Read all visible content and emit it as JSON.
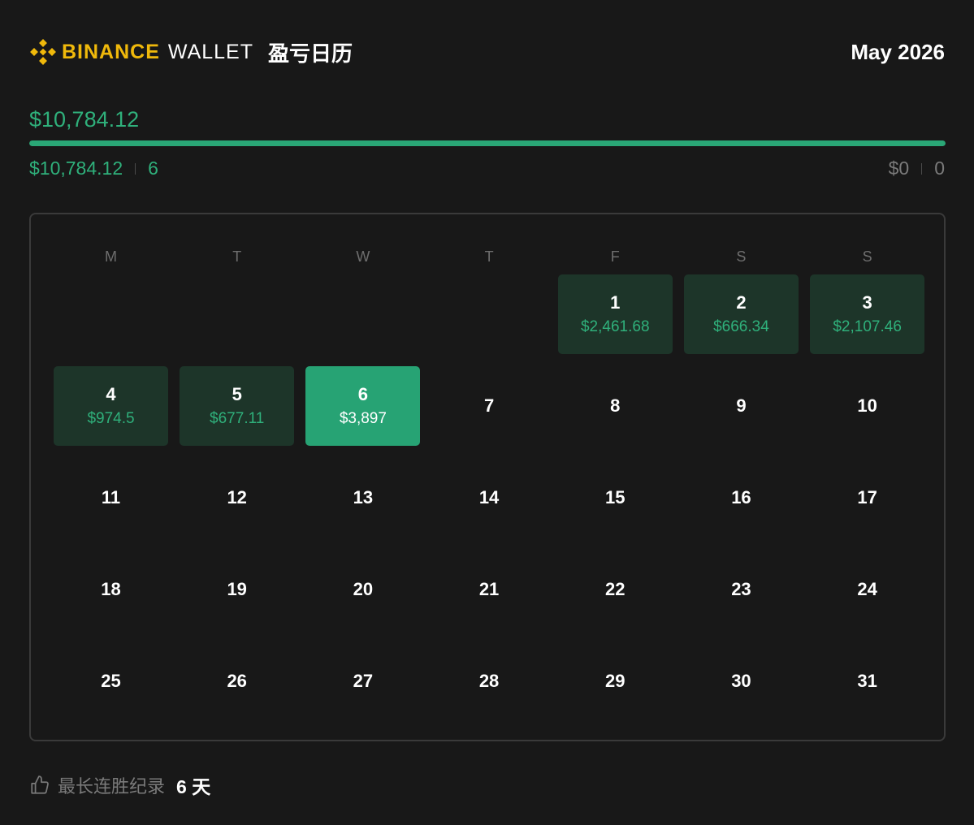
{
  "header": {
    "brand_binance": "BINANCE",
    "brand_wallet": "WALLET",
    "title": "盈亏日历",
    "month": "May 2026",
    "logo_icon": "binance-logo-icon",
    "brand_color": "#f0b90b"
  },
  "summary": {
    "total_pnl": "$10,784.12",
    "profit_share": 1.0,
    "profit_total": "$10,784.12",
    "profit_days": "6",
    "loss_total": "$0",
    "loss_days": "0",
    "profit_color": "#2fb07b"
  },
  "calendar": {
    "weekdays": [
      "M",
      "T",
      "W",
      "T",
      "F",
      "S",
      "S"
    ],
    "days": [
      {
        "num": "",
        "value": "",
        "state": "blank"
      },
      {
        "num": "",
        "value": "",
        "state": "blank"
      },
      {
        "num": "",
        "value": "",
        "state": "blank"
      },
      {
        "num": "",
        "value": "",
        "state": "blank"
      },
      {
        "num": "1",
        "value": "$2,461.68",
        "state": "profit"
      },
      {
        "num": "2",
        "value": "$666.34",
        "state": "profit"
      },
      {
        "num": "3",
        "value": "$2,107.46",
        "state": "profit"
      },
      {
        "num": "4",
        "value": "$974.5",
        "state": "profit"
      },
      {
        "num": "5",
        "value": "$677.11",
        "state": "profit"
      },
      {
        "num": "6",
        "value": "$3,897",
        "state": "best"
      },
      {
        "num": "7",
        "value": "",
        "state": "empty"
      },
      {
        "num": "8",
        "value": "",
        "state": "empty"
      },
      {
        "num": "9",
        "value": "",
        "state": "empty"
      },
      {
        "num": "10",
        "value": "",
        "state": "empty"
      },
      {
        "num": "11",
        "value": "",
        "state": "empty"
      },
      {
        "num": "12",
        "value": "",
        "state": "empty"
      },
      {
        "num": "13",
        "value": "",
        "state": "empty"
      },
      {
        "num": "14",
        "value": "",
        "state": "empty"
      },
      {
        "num": "15",
        "value": "",
        "state": "empty"
      },
      {
        "num": "16",
        "value": "",
        "state": "empty"
      },
      {
        "num": "17",
        "value": "",
        "state": "empty"
      },
      {
        "num": "18",
        "value": "",
        "state": "empty"
      },
      {
        "num": "19",
        "value": "",
        "state": "empty"
      },
      {
        "num": "20",
        "value": "",
        "state": "empty"
      },
      {
        "num": "21",
        "value": "",
        "state": "empty"
      },
      {
        "num": "22",
        "value": "",
        "state": "empty"
      },
      {
        "num": "23",
        "value": "",
        "state": "empty"
      },
      {
        "num": "24",
        "value": "",
        "state": "empty"
      },
      {
        "num": "25",
        "value": "",
        "state": "empty"
      },
      {
        "num": "26",
        "value": "",
        "state": "empty"
      },
      {
        "num": "27",
        "value": "",
        "state": "empty"
      },
      {
        "num": "28",
        "value": "",
        "state": "empty"
      },
      {
        "num": "29",
        "value": "",
        "state": "empty"
      },
      {
        "num": "30",
        "value": "",
        "state": "empty"
      },
      {
        "num": "31",
        "value": "",
        "state": "empty"
      }
    ]
  },
  "footer": {
    "icon": "thumbs-up-icon",
    "streak_label": "最长连胜纪录",
    "streak_value": "6 天"
  }
}
